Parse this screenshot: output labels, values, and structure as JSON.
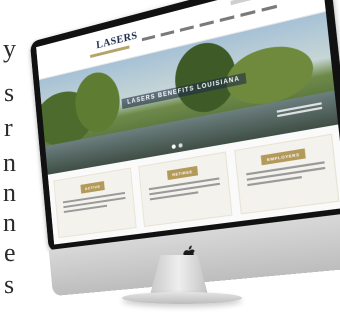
{
  "side_text": {
    "letters": [
      "y",
      "s",
      "r",
      "n",
      "n",
      "n",
      "e",
      "s"
    ]
  },
  "hero": {
    "title": "LASERS BENEFITS LOUISIANA"
  },
  "logo": {
    "text": "LASERS"
  },
  "cards": [
    {
      "button_label": "ACTIVE"
    },
    {
      "button_label": "RETIREE"
    },
    {
      "button_label": "EMPLOYERS"
    }
  ],
  "colors": {
    "navy": "#1a2a4a",
    "gold": "#b49a5a"
  }
}
